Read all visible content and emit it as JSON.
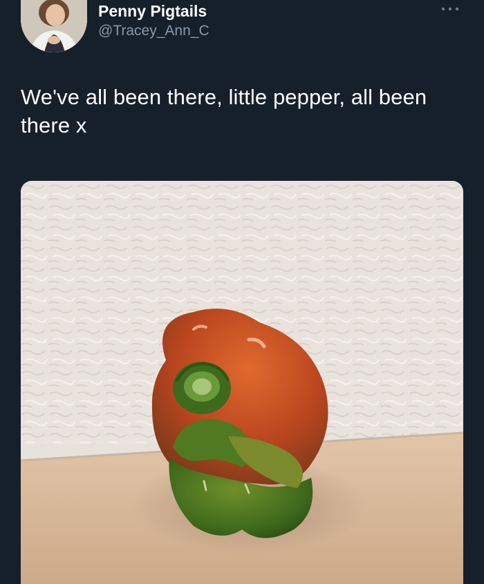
{
  "author": {
    "display_name": "Penny Pigtails",
    "handle": "@Tracey_Ann_C",
    "avatar_icon": "profile-photo-avatar"
  },
  "menu": {
    "icon": "more-dots-icon"
  },
  "tweet": {
    "text": "We've all been there, little pepper, all been there x"
  },
  "media": {
    "kind": "photo",
    "icon": "bell-pepper-photo"
  },
  "colors": {
    "background": "#15202b",
    "text": "#ffffff",
    "secondary_text": "#8b98a5"
  }
}
